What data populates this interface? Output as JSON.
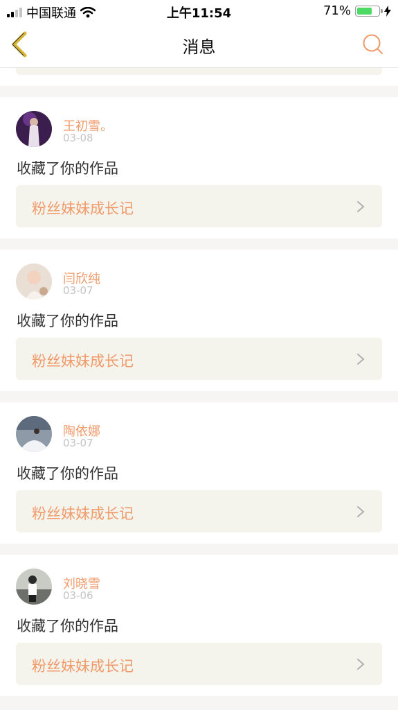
{
  "status_bar": {
    "carrier": "中国联通",
    "time": "上午11:54",
    "battery_percent_text": "71%",
    "battery_level": 0.71
  },
  "nav": {
    "title": "消息",
    "accent_color": "#f09a6a",
    "back_icon_color": "#d8b533"
  },
  "messages": [
    {
      "user": "王初雪。",
      "date": "03-08",
      "action": "收藏了你的作品",
      "work_title": "粉丝妹妹成长记"
    },
    {
      "user": "闫欣纯",
      "date": "03-07",
      "action": "收藏了你的作品",
      "work_title": "粉丝妹妹成长记"
    },
    {
      "user": "陶依娜",
      "date": "03-07",
      "action": "收藏了你的作品",
      "work_title": "粉丝妹妹成长记"
    },
    {
      "user": "刘晓雪",
      "date": "03-06",
      "action": "收藏了你的作品",
      "work_title": "粉丝妹妹成长记"
    }
  ]
}
